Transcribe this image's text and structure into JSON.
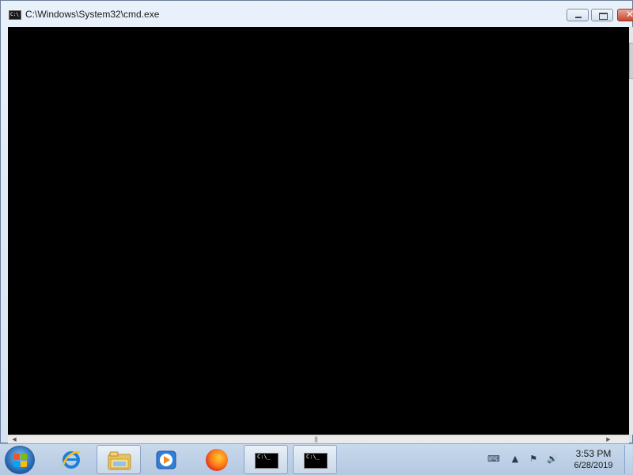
{
  "window": {
    "title": "C:\\Windows\\System32\\cmd.exe",
    "icon_label": "C:\\",
    "controls": [
      "minimize",
      "maximize",
      "close"
    ]
  },
  "console": {
    "text": ""
  },
  "taskbar": {
    "buttons": [
      {
        "name": "Internet Explorer",
        "icon": "ie-icon"
      },
      {
        "name": "Windows Explorer",
        "icon": "folder-icon",
        "active": true
      },
      {
        "name": "Windows Media Player",
        "icon": "media-player-icon"
      },
      {
        "name": "Firefox",
        "icon": "firefox-icon"
      },
      {
        "name": "Command Prompt",
        "icon": "cmd-icon",
        "label": "C:\\_",
        "active": true
      },
      {
        "name": "Command Prompt",
        "icon": "cmd-icon",
        "label": "C:\\_",
        "active": true
      }
    ],
    "tray": {
      "icons": [
        "keyboard-icon",
        "show-hidden-icons",
        "action-center-flag-icon",
        "volume-icon"
      ],
      "time": "3:53 PM",
      "date": "6/28/2019"
    }
  }
}
